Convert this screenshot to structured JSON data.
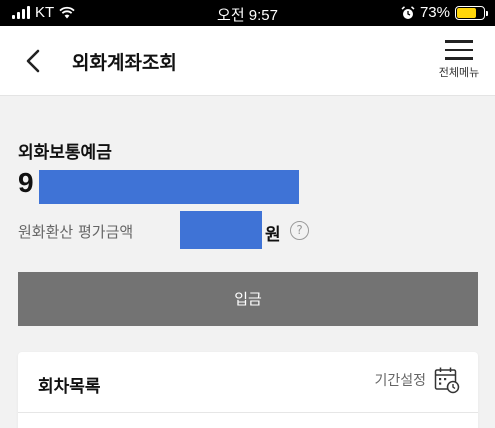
{
  "status_bar": {
    "carrier": "KT",
    "time": "오전 9:57",
    "battery_percent_label": "73%",
    "battery_level": 0.73,
    "icons": [
      "signal-icon",
      "wifi-icon",
      "alarm-icon",
      "battery-icon"
    ]
  },
  "header": {
    "title": "외화계좌조회",
    "menu_label": "전체메뉴",
    "icons": [
      "back-chevron-icon",
      "hamburger-menu-icon"
    ]
  },
  "account": {
    "type": "외화보통예금",
    "number_prefix": "9",
    "eval_label": "원화환산 평가금액",
    "currency_unit": "원",
    "help_symbol": "?",
    "mask_color": "#3f73d6"
  },
  "deposit_button": {
    "label": "입금",
    "color": "#737373"
  },
  "round_list": {
    "title": "회차목록",
    "period_label": "기간설정",
    "icon": "calendar-settings-icon"
  }
}
